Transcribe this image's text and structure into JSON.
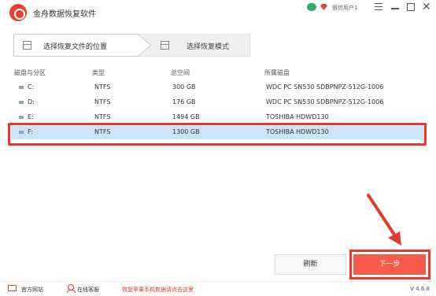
{
  "app": {
    "title": "金舟数据恢复软件"
  },
  "titlebar": {
    "user": "微信用户1"
  },
  "steps": [
    {
      "label": "选择恢复文件的位置"
    },
    {
      "label": "选择恢复模式"
    }
  ],
  "table": {
    "headers": [
      "磁盘与分区",
      "类型",
      "总空间",
      "所属磁盘"
    ],
    "rows": [
      {
        "partition": "C:",
        "type": "NTFS",
        "size": "300 GB",
        "disk": "WDC PC SN530 SDBPNPZ-512G-1006"
      },
      {
        "partition": "D:",
        "type": "NTFS",
        "size": "176 GB",
        "disk": "WDC PC SN530 SDBPNPZ-512G-1006"
      },
      {
        "partition": "E:",
        "type": "NTFS",
        "size": "1494 GB",
        "disk": "TOSHIBA HDWD130"
      },
      {
        "partition": "F:",
        "type": "NTFS",
        "size": "1300 GB",
        "disk": "TOSHIBA HDWD130"
      }
    ],
    "selected_row": 3
  },
  "buttons": {
    "refresh": "刷新",
    "next": "下一步"
  },
  "footer": {
    "website": "官方网站",
    "service": "在线客服",
    "promo": "恢复苹果手机数据请点击这里",
    "version": "V 4.6.8"
  },
  "colors": {
    "accent": "#f55a4a",
    "highlight": "#e23a2c",
    "selected_row": "#cce4f7"
  },
  "icons": [
    "app-logo-icon",
    "wechat-icon",
    "vip-icon",
    "menu-icon",
    "minimize-icon",
    "maximize-icon",
    "close-icon",
    "drive-icon",
    "website-icon",
    "service-icon"
  ]
}
